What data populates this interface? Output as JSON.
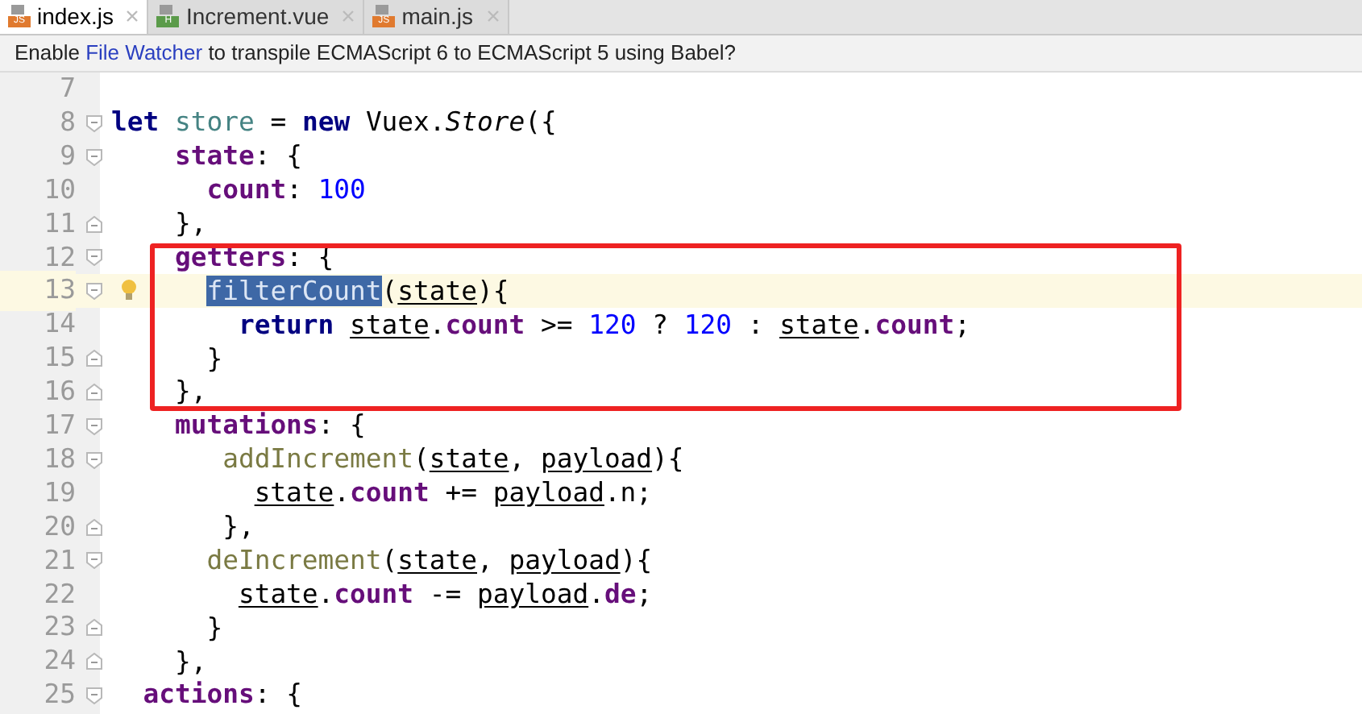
{
  "tabs": [
    {
      "label": "index.js",
      "icon": "JS",
      "selected": true
    },
    {
      "label": "Increment.vue",
      "icon": "H",
      "selected": false
    },
    {
      "label": "main.js",
      "icon": "JS",
      "selected": false
    }
  ],
  "banner": {
    "before": "Enable ",
    "link": "File Watcher",
    "after": " to transpile ECMAScript 6 to ECMAScript 5 using Babel?"
  },
  "editor": {
    "lines": [
      {
        "number": "7",
        "current": false
      },
      {
        "number": "8",
        "current": false,
        "marker": {
          "kind": "start"
        },
        "tokens": [
          {
            "t": "let",
            "kind": "keyword"
          },
          {
            "t": " store",
            "kind": "unused"
          },
          {
            "t": " = "
          },
          {
            "t": "new",
            "kind": "keyword"
          },
          {
            "t": " Vuex."
          },
          {
            "t": "Store",
            "kind": "italic"
          },
          {
            "t": "({"
          }
        ]
      },
      {
        "number": "9",
        "current": false,
        "marker": {
          "kind": "start"
        },
        "tokens": [
          {
            "t": "    state",
            "kind": "property"
          },
          {
            "t": ": {"
          }
        ]
      },
      {
        "number": "10",
        "current": false,
        "tokens": [
          {
            "t": "      count",
            "kind": "property"
          },
          {
            "t": ": "
          },
          {
            "t": "100",
            "kind": "number"
          }
        ]
      },
      {
        "number": "11",
        "current": false,
        "marker": {
          "kind": "end"
        },
        "tokens": [
          {
            "t": "    },"
          }
        ]
      },
      {
        "number": "12",
        "current": false,
        "marker": {
          "kind": "start"
        },
        "tokens": [
          {
            "t": "    getters",
            "kind": "property"
          },
          {
            "t": ": {"
          }
        ]
      },
      {
        "number": "13",
        "current": true,
        "intention": true,
        "marker": {
          "kind": "start"
        },
        "tokens": [
          {
            "t": "      filterCount",
            "kind": "selected"
          },
          {
            "t": "("
          },
          {
            "t": "state",
            "kind": "param"
          },
          {
            "t": "){"
          }
        ]
      },
      {
        "number": "14",
        "current": false,
        "tokens": [
          {
            "t": "        return",
            "kind": "keyword"
          },
          {
            "t": " state",
            "kind": "param"
          },
          {
            "t": "."
          },
          {
            "t": "count",
            "kind": "property"
          },
          {
            "t": " >= "
          },
          {
            "t": "120",
            "kind": "number"
          },
          {
            "t": " ? "
          },
          {
            "t": "120",
            "kind": "number"
          },
          {
            "t": " : "
          },
          {
            "t": "state",
            "kind": "param"
          },
          {
            "t": "."
          },
          {
            "t": "count",
            "kind": "property"
          },
          {
            "t": ";"
          }
        ]
      },
      {
        "number": "15",
        "current": false,
        "marker": {
          "kind": "end"
        },
        "tokens": [
          {
            "t": "      }"
          }
        ]
      },
      {
        "number": "16",
        "current": false,
        "marker": {
          "kind": "end"
        },
        "tokens": [
          {
            "t": "    },"
          }
        ]
      },
      {
        "number": "17",
        "current": false,
        "marker": {
          "kind": "start"
        },
        "tokens": [
          {
            "t": "    mutations",
            "kind": "property"
          },
          {
            "t": ": {"
          }
        ]
      },
      {
        "number": "18",
        "current": false,
        "marker": {
          "kind": "start"
        },
        "tokens": [
          {
            "t": "       addIncrement",
            "kind": "method"
          },
          {
            "t": "("
          },
          {
            "t": "state",
            "kind": "param"
          },
          {
            "t": ", "
          },
          {
            "t": "payload",
            "kind": "param"
          },
          {
            "t": "){"
          }
        ]
      },
      {
        "number": "19",
        "current": false,
        "tokens": [
          {
            "t": "         state",
            "kind": "param"
          },
          {
            "t": "."
          },
          {
            "t": "count",
            "kind": "property"
          },
          {
            "t": " += "
          },
          {
            "t": "payload",
            "kind": "param"
          },
          {
            "t": ".n;"
          }
        ]
      },
      {
        "number": "20",
        "current": false,
        "marker": {
          "kind": "end"
        },
        "tokens": [
          {
            "t": "       },"
          }
        ]
      },
      {
        "number": "21",
        "current": false,
        "marker": {
          "kind": "start"
        },
        "tokens": [
          {
            "t": "      deIncrement",
            "kind": "method"
          },
          {
            "t": "("
          },
          {
            "t": "state",
            "kind": "param"
          },
          {
            "t": ", "
          },
          {
            "t": "payload",
            "kind": "param"
          },
          {
            "t": "){"
          }
        ]
      },
      {
        "number": "22",
        "current": false,
        "tokens": [
          {
            "t": "        state",
            "kind": "param"
          },
          {
            "t": "."
          },
          {
            "t": "count",
            "kind": "property"
          },
          {
            "t": " -= "
          },
          {
            "t": "payload",
            "kind": "param"
          },
          {
            "t": "."
          },
          {
            "t": "de",
            "kind": "property"
          },
          {
            "t": ";"
          }
        ]
      },
      {
        "number": "23",
        "current": false,
        "marker": {
          "kind": "end"
        },
        "tokens": [
          {
            "t": "      }"
          }
        ]
      },
      {
        "number": "24",
        "current": false,
        "marker": {
          "kind": "end"
        },
        "tokens": [
          {
            "t": "    },"
          }
        ]
      },
      {
        "number": "25",
        "current": false,
        "marker": {
          "kind": "start"
        },
        "tokens": [
          {
            "t": "  actions",
            "kind": "property"
          },
          {
            "t": ": {"
          }
        ]
      }
    ]
  }
}
